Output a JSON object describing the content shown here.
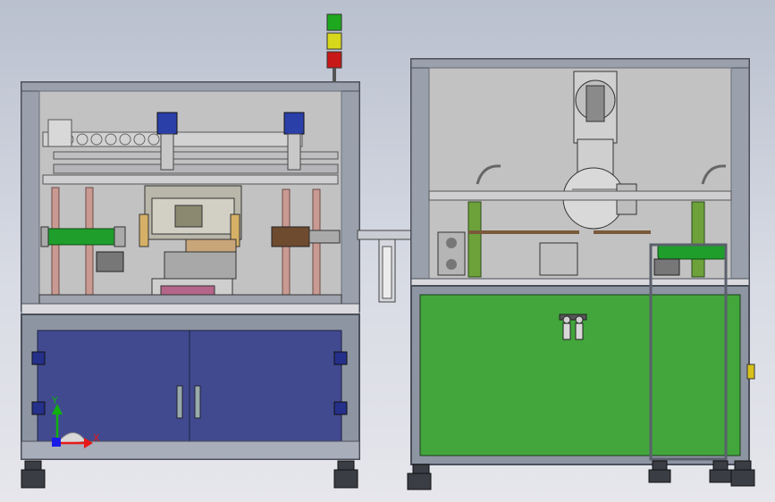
{
  "triad": {
    "x_label": "X",
    "y_label": "Y",
    "x_color": "#e81919",
    "y_color": "#11b011",
    "z_color": "#1b1be8"
  },
  "colors": {
    "frame": "#8d95a3",
    "frame_dark": "#4a4f5a",
    "cabinet_door": "#414a8f",
    "panel_green": "#42a63c",
    "roller_green": "#1f9e2c",
    "lamp_green": "#1ea81e",
    "lamp_yellow": "#d7d71c",
    "lamp_red": "#c81818",
    "post_pink": "#c99a92"
  },
  "icons": {
    "signal_tower": "stack-light-icon",
    "triad": "coordinate-triad-icon"
  }
}
